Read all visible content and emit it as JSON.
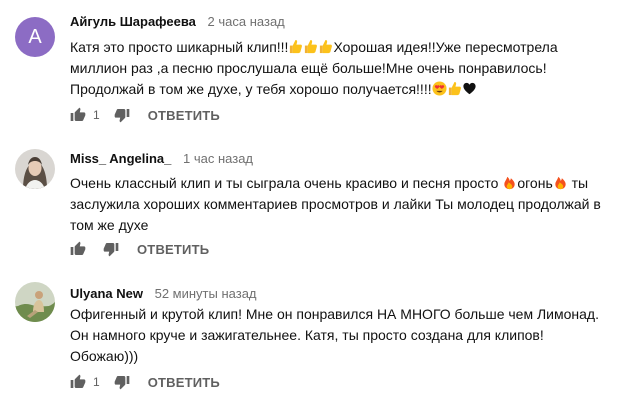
{
  "comments": [
    {
      "author": "Айгуль Шарафеева",
      "time": "2 часа назад",
      "avatar_letter": "А",
      "text_1": "Катя это просто шикарный клип!!!",
      "text_2": "Хорошая идея!!Уже пересмотрела\nмиллион раз ,а песню прослушала ещё больше!Мне очень понравилось!\nПродолжай в том же духе, у тебя хорошо получается!!!!",
      "likes": "1",
      "reply_label": "ОТВЕТИТЬ"
    },
    {
      "author": "Miss_ Angelina_",
      "time": "1 час назад",
      "text_1": "Очень классный клип и ты сыграла очень красиво и песня просто ",
      "text_2": "огонь",
      "text_3": " ты\nзаслужила хороших комментариев просмотров и лайки Ты молодец продолжай в\nтом же духе",
      "reply_label": "ОТВЕТИТЬ"
    },
    {
      "author": "Ulyana New",
      "time": "52 минуты назад",
      "text_1": "Офигенный и крутой клип! Мне он понравился НА МНОГО больше чем Лимонад.\nОн намного круче и зажигательнее. Катя, ты просто создана для клипов!\nОбожаю)))",
      "likes": "1",
      "reply_label": "ОТВЕТИТЬ"
    }
  ],
  "icons": {
    "like": "thumb-up-icon",
    "dislike": "thumb-down-icon",
    "emoji_thumb": "thumbs-up-emoji",
    "emoji_fire": "fire-emoji",
    "emoji_heart_eyes": "heart-eyes-emoji",
    "emoji_black_heart": "black-heart-emoji"
  },
  "colors": {
    "avatar_letter_bg": "#8c6cc4",
    "secondary_text": "#606060",
    "time_text": "#707070"
  }
}
